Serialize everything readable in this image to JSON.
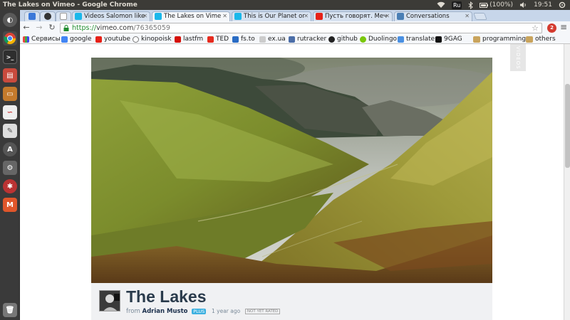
{
  "system_panel": {
    "window_title": "The Lakes on Vimeo - Google Chrome",
    "keyboard_layout": "Ru",
    "battery": "(100%)",
    "clock": "19:51"
  },
  "browser": {
    "tabs": [
      {
        "label": "",
        "favicon": "upload-icon",
        "color": "#3b78d8"
      },
      {
        "label": "",
        "favicon": "github-icon",
        "color": "#333333"
      },
      {
        "label": "",
        "favicon": "blank-page-icon",
        "color": "#ffffff"
      },
      {
        "label": "Videos Salomon like",
        "favicon": "vimeo-icon",
        "color": "#1ab7ea"
      },
      {
        "label": "The Lakes on Vime",
        "favicon": "vimeo-play-icon",
        "color": "#1ab7ea",
        "active": true
      },
      {
        "label": "This is Our Planet or",
        "favicon": "pause-icon",
        "color": "#1ab7ea"
      },
      {
        "label": "Пусть говорят. Меч",
        "favicon": "youtube-icon",
        "color": "#e62117"
      },
      {
        "label": "Conversations",
        "favicon": "chat-icon",
        "color": "#4a7fb5"
      }
    ],
    "url": {
      "scheme": "https://",
      "host": "vimeo.com",
      "path": "/76365059"
    },
    "extension_badge": "2",
    "bookmarks": [
      {
        "label": "Сервисы",
        "icon": "apps-icon",
        "color": "#e44"
      },
      {
        "label": "google",
        "icon": "google-icon",
        "color": "#4285f4"
      },
      {
        "label": "youtube",
        "icon": "youtube-icon",
        "color": "#e62117"
      },
      {
        "label": "kinopoisk",
        "icon": "film-icon",
        "color": "#777"
      },
      {
        "label": "lastfm",
        "icon": "lastfm-icon",
        "color": "#d51007"
      },
      {
        "label": "TED",
        "icon": "ted-icon",
        "color": "#e62b1e"
      },
      {
        "label": "fs.to",
        "icon": "arrow-up-icon",
        "color": "#2a6cc4"
      },
      {
        "label": "ex.ua",
        "icon": "exua-icon",
        "color": "#888"
      },
      {
        "label": "rutracker",
        "icon": "rutracker-icon",
        "color": "#4c6ea8"
      },
      {
        "label": "github",
        "icon": "github-icon",
        "color": "#222"
      },
      {
        "label": "Duolingo",
        "icon": "duolingo-icon",
        "color": "#7ac70c"
      },
      {
        "label": "translater",
        "icon": "translate-icon",
        "color": "#4a90e2"
      },
      {
        "label": "9GAG",
        "icon": "9gag-icon",
        "color": "#111"
      },
      {
        "label": "programming",
        "icon": "folder-icon",
        "color": "#c9a45c"
      },
      {
        "label": "others",
        "icon": "folder-icon",
        "color": "#c9a45c"
      }
    ]
  },
  "page": {
    "side_tab_label": "VIDEOS",
    "video": {
      "title": "The Lakes",
      "from_label": "from",
      "author": "Adrian Musto",
      "badge": "PLUS",
      "time_ago": "1 year ago",
      "rating_badge": "NOT YET RATED"
    }
  }
}
